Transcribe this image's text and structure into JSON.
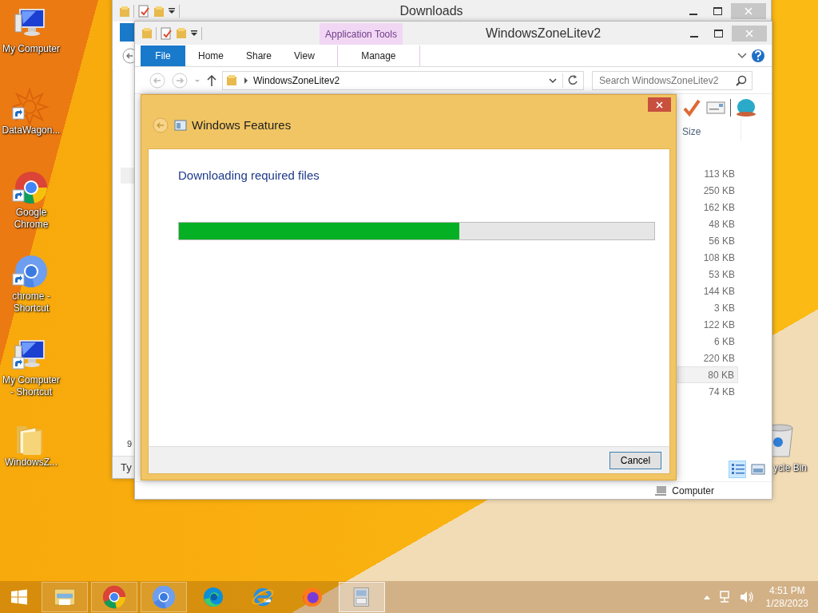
{
  "desktop_icons": [
    {
      "kind": "computer",
      "label": "My Computer",
      "shortcut": false
    },
    {
      "kind": "starburst",
      "label": "DataWagon...",
      "shortcut": true
    },
    {
      "kind": "chrome",
      "label": "Google Chrome",
      "shortcut": true
    },
    {
      "kind": "chromium",
      "label": "chrome - Shortcut",
      "shortcut": true
    },
    {
      "kind": "computer",
      "label": "My Computer - Shortcut",
      "shortcut": true
    },
    {
      "kind": "folder",
      "label": "WindowsZ...",
      "shortcut": false
    }
  ],
  "recycle_bin": {
    "label": "ycle Bin"
  },
  "back_window": {
    "title": "Downloads",
    "cell": "9",
    "status": "Ty"
  },
  "explorer": {
    "title": "WindowsZoneLitev2",
    "context_group": "Application Tools",
    "tabs": [
      {
        "label": "File",
        "kind": "file"
      },
      {
        "label": "Home",
        "kind": "tab"
      },
      {
        "label": "Share",
        "kind": "tab"
      },
      {
        "label": "View",
        "kind": "tab"
      },
      {
        "label": "Manage",
        "kind": "context"
      }
    ],
    "address": "WindowsZoneLitev2",
    "search": {
      "placeholder": "Search WindowsZoneLitev2"
    },
    "column": "Size",
    "rows": [
      {
        "size": "113 KB",
        "selected": false
      },
      {
        "size": "250 KB",
        "selected": false
      },
      {
        "size": "162 KB",
        "selected": false
      },
      {
        "size": "48 KB",
        "selected": false
      },
      {
        "size": "56 KB",
        "selected": false
      },
      {
        "size": "108 KB",
        "selected": false
      },
      {
        "size": "53 KB",
        "selected": false
      },
      {
        "size": "144 KB",
        "selected": false
      },
      {
        "size": "3 KB",
        "selected": false
      },
      {
        "size": "122 KB",
        "selected": false
      },
      {
        "size": "6 KB",
        "selected": false
      },
      {
        "size": "220 KB",
        "selected": false
      },
      {
        "size": "80 KB",
        "selected": true
      },
      {
        "size": "74 KB",
        "selected": false
      }
    ],
    "views": [
      {
        "kind": "details",
        "selected": true
      },
      {
        "kind": "large-icons",
        "selected": false
      }
    ],
    "status": "Computer"
  },
  "dialog": {
    "title": "Windows Features",
    "heading": "Downloading required files",
    "progress": {
      "level": 0.59
    },
    "buttons": [
      "Cancel"
    ]
  },
  "taskbar": {
    "apps": [
      {
        "kind": "explorer",
        "running": true,
        "selected": false
      },
      {
        "kind": "chrome",
        "running": true,
        "selected": false
      },
      {
        "kind": "chromium",
        "running": true,
        "selected": false
      },
      {
        "kind": "edge",
        "running": false,
        "selected": false
      },
      {
        "kind": "ie",
        "running": false,
        "selected": false
      },
      {
        "kind": "firefox",
        "running": false,
        "selected": false
      },
      {
        "kind": "setup",
        "running": true,
        "selected": true
      }
    ],
    "time": "4:51 PM",
    "date": "1/28/2023"
  }
}
